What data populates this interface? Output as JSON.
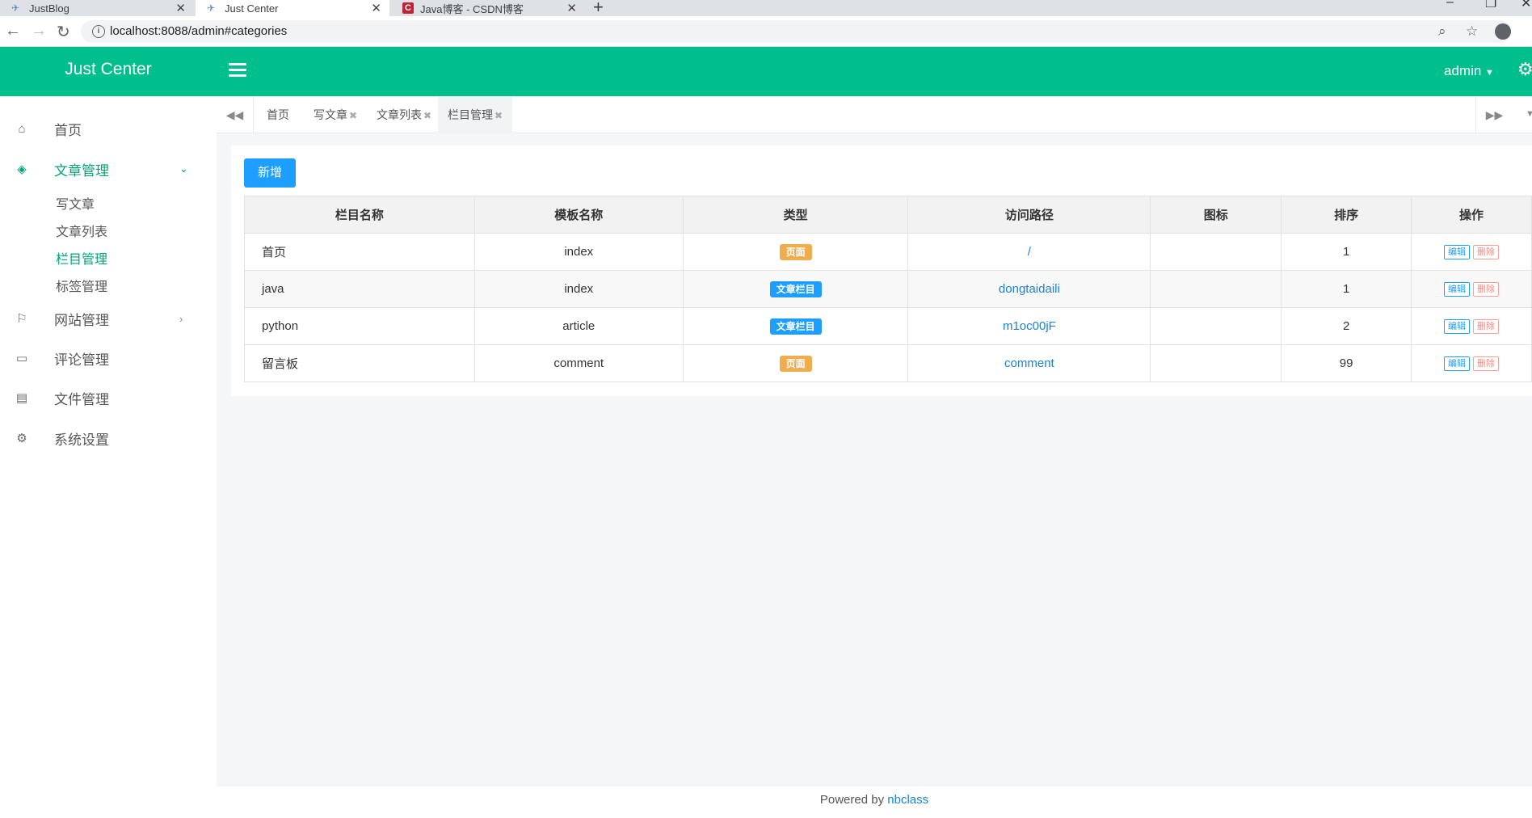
{
  "browser": {
    "tabs": [
      {
        "title": "JustBlog",
        "active": false
      },
      {
        "title": "Just Center",
        "active": true
      },
      {
        "title": "Java博客 - CSDN博客",
        "active": false
      }
    ],
    "url": "localhost:8088/admin#categories"
  },
  "header": {
    "brand": "Just Center",
    "user": "admin"
  },
  "sidebar": {
    "items": [
      {
        "label": "首页",
        "icon": "home-icon"
      },
      {
        "label": "文章管理",
        "icon": "layers-icon",
        "expanded": true,
        "children": [
          "写文章",
          "文章列表",
          "栏目管理",
          "标签管理"
        ],
        "active_child": "栏目管理"
      },
      {
        "label": "网站管理",
        "icon": "flag-icon"
      },
      {
        "label": "评论管理",
        "icon": "comment-icon"
      },
      {
        "label": "文件管理",
        "icon": "file-icon"
      },
      {
        "label": "系统设置",
        "icon": "gear-icon"
      }
    ]
  },
  "page_tabs": [
    {
      "label": "首页",
      "closable": false
    },
    {
      "label": "写文章",
      "closable": true
    },
    {
      "label": "文章列表",
      "closable": true
    },
    {
      "label": "栏目管理",
      "closable": true,
      "active": true
    }
  ],
  "toolbar": {
    "add_label": "新增"
  },
  "table": {
    "columns": [
      "栏目名称",
      "模板名称",
      "类型",
      "访问路径",
      "图标",
      "排序",
      "操作"
    ],
    "rows": [
      {
        "name": "首页",
        "template": "index",
        "type": "页面",
        "type_kind": "page",
        "path": "/",
        "icon": "",
        "order": "1"
      },
      {
        "name": "java",
        "template": "index",
        "type": "文章栏目",
        "type_kind": "column",
        "path": "dongtaidaili",
        "icon": "",
        "order": "1"
      },
      {
        "name": "python",
        "template": "article",
        "type": "文章栏目",
        "type_kind": "column",
        "path": "m1oc00jF",
        "icon": "",
        "order": "2"
      },
      {
        "name": "留言板",
        "template": "comment",
        "type": "页面",
        "type_kind": "page",
        "path": "comment",
        "icon": "",
        "order": "99"
      }
    ],
    "edit_label": "编辑",
    "delete_label": "删除"
  },
  "footer": {
    "prefix": "Powered by",
    "link": "nbclass"
  },
  "colors": {
    "header": "#00bf8c",
    "accent": "#00a67a",
    "primary_button": "#1e9fff",
    "page_badge": "#f0ad4e"
  }
}
